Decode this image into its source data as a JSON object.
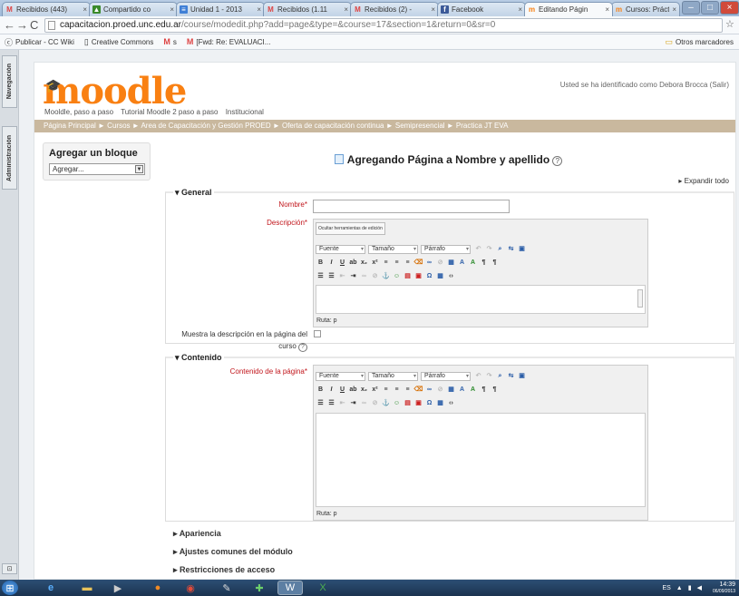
{
  "browser": {
    "tabs": [
      {
        "label": "Recibidos (443)",
        "icon": "gmail-icon"
      },
      {
        "label": "Compartido co",
        "icon": "drive-icon"
      },
      {
        "label": "Unidad 1 - 2013",
        "icon": "document-icon"
      },
      {
        "label": "Recibidos (1.11",
        "icon": "gmail-icon"
      },
      {
        "label": "Recibidos (2) - ",
        "icon": "gmail-icon"
      },
      {
        "label": "Facebook",
        "icon": "facebook-icon"
      },
      {
        "label": "Editando Págin",
        "icon": "moodle-icon",
        "active": true
      },
      {
        "label": "Cursos: Práctica",
        "icon": "moodle-icon"
      }
    ],
    "url_host": "capacitacion.proed.unc.edu.ar",
    "url_path": "/course/modedit.php?add=page&type=&course=17&section=1&return=0&sr=0",
    "bookmarks": [
      {
        "label": "Publicar - CC Wiki",
        "icon": "cc-icon"
      },
      {
        "label": "Creative Commons",
        "icon": "page-icon"
      },
      {
        "label": "s",
        "icon": "gmail-icon"
      },
      {
        "label": "[Fwd: Re: EVALUACI...",
        "icon": "gmail-icon"
      }
    ],
    "other_bookmarks": "Otros marcadores"
  },
  "dock": {
    "items": [
      "Navegación",
      "Administración"
    ]
  },
  "site": {
    "logo": "moodle",
    "login_text": "Usted se ha identificado como Debora Brocca (Salir)",
    "menu": [
      "Mooldle, paso a paso",
      "Tutorial Moodle 2 paso a paso",
      "Institucional"
    ],
    "breadcrumb": "Página Principal ► Cursos ► Area de Capacitación y Gestión PROED ► Oferta de capacitación continua ► Semipresencial ► Practica JT EVA"
  },
  "block": {
    "title": "Agregar un bloque",
    "select_value": "Agregar..."
  },
  "form": {
    "heading": "Agregando Página a Nombre y apellido",
    "expand_all": "Expandir todo",
    "general": {
      "legend": "General",
      "name_label": "Nombre*",
      "desc_label": "Descripción*",
      "hide_tools": "Ocultar herramientas de edición",
      "show_desc_label_1": "Muestra la descripción en la página del",
      "show_desc_label_2": "curso"
    },
    "editor": {
      "font": "Fuente",
      "size": "Tamaño",
      "format": "Párrafo",
      "path": "Ruta: p"
    },
    "content": {
      "legend": "Contenido",
      "label": "Contenido de la página*"
    },
    "sections": [
      "Apariencia",
      "Ajustes comunes del módulo",
      "Restricciones de acceso"
    ]
  },
  "taskbar": {
    "lang": "ES",
    "time": "14:39",
    "date": "06/09/2013"
  },
  "colors": {
    "moodle_orange": "#f98012",
    "breadcrumb_bg": "#c9b89e",
    "required_red": "#c1151b"
  }
}
